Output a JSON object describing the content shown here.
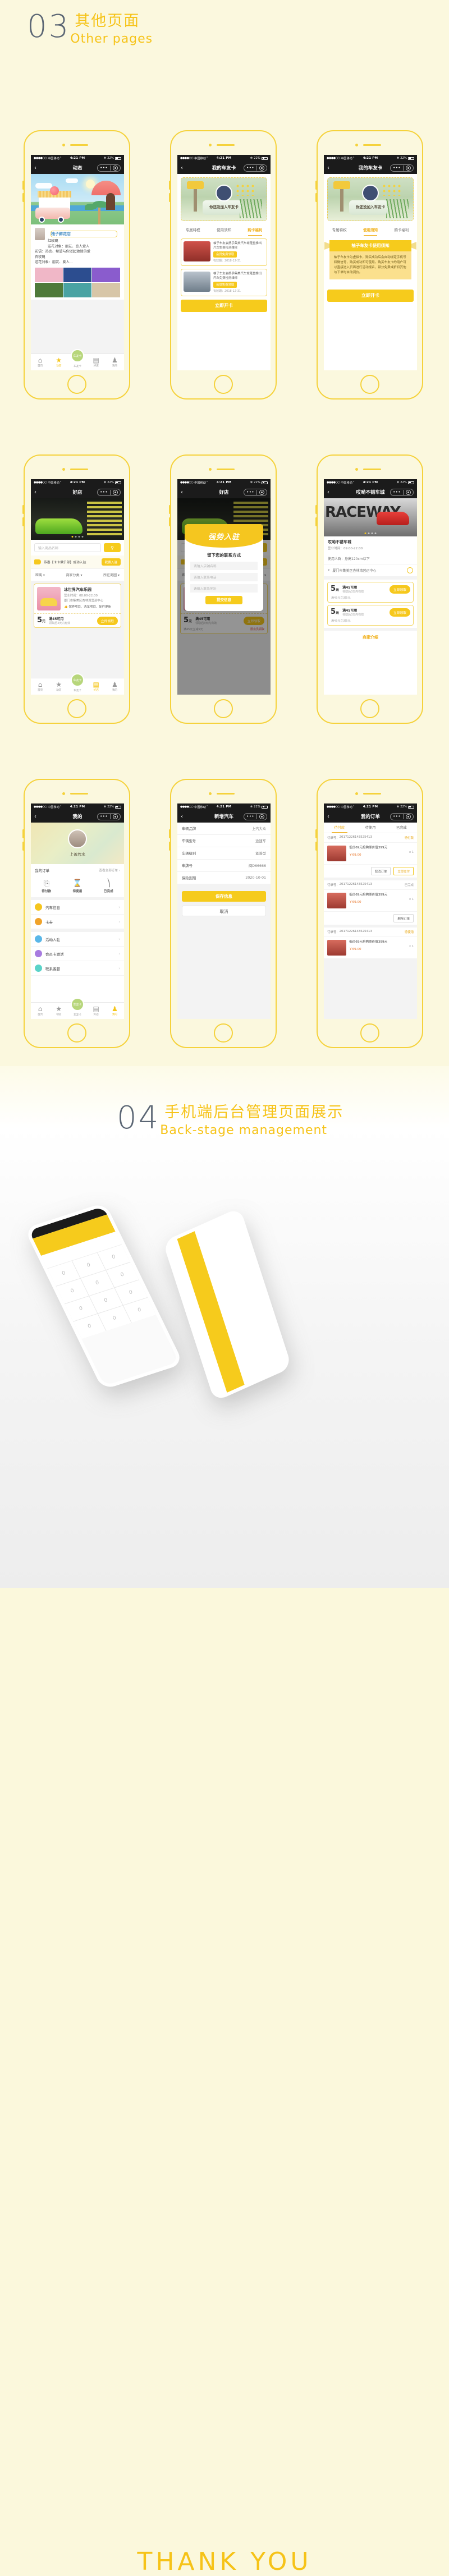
{
  "sections": {
    "other": {
      "num": "03",
      "cn": "其他页面",
      "en": "Other pages"
    },
    "backstage": {
      "num": "04",
      "cn": "手机端后台管理页面展示",
      "en": "Back-stage management"
    },
    "thanks": "THANK  YOU"
  },
  "status_bar": {
    "dots": "●●●●○○",
    "carrier": "中国移动",
    "wifi": "⌃",
    "time": "4:21 PM",
    "bluetooth": "✻",
    "battery": "22%"
  },
  "nav_icons": {
    "back": "‹",
    "more": "•••",
    "target": "◉"
  },
  "screens": [
    {
      "id": "dynamic-feed",
      "title": "动态",
      "post": {
        "shop": "柚子鲜花店",
        "lines": [
          "红玫瑰",
          "送花对象：朋友、恋人爱人",
          "花语：热恋、希望与你泛起激情的爱",
          "白玫瑰",
          "送花对象：朋友、爱人..."
        ],
        "photos": [
          "#f0b7c7",
          "#2c4d8f",
          "#8a5ccd",
          "#4f7a3a",
          "#49a3a3",
          "#d7c6a8"
        ]
      },
      "tabbar": [
        {
          "label": "首页",
          "glyph": "🏠",
          "active": false
        },
        {
          "label": "动态",
          "glyph": "★",
          "active": true
        },
        {
          "label": "车友卡",
          "glyph": "车友卡",
          "active": false,
          "center": true
        },
        {
          "label": "好店",
          "glyph": "🏪",
          "active": false
        },
        {
          "label": "我的",
          "glyph": "👤",
          "active": false
        }
      ]
    },
    {
      "id": "member-card-benefits",
      "title": "我的车友卡",
      "card_caption": "你还没加入车友卡",
      "tabs": [
        {
          "label": "专属特权",
          "active": false
        },
        {
          "label": "使用须知",
          "active": false
        },
        {
          "label": "购卡福利",
          "active": true
        }
      ],
      "coupons": [
        {
          "text": "柚子车友会携手集美汽车城隆重推出汽车免费检测维修",
          "pill": "会员免费领取",
          "expiry": "有效期：2018-12-31"
        },
        {
          "text": "柚子车友会携手集美汽车城隆重推出汽车免费检测维修",
          "pill": "会员免费领取",
          "expiry": "有效期：2018-12-31"
        }
      ],
      "cta": "立即开卡"
    },
    {
      "id": "member-card-notice",
      "title": "我的车友卡",
      "card_caption": "你还没加入车友卡",
      "tabs": [
        {
          "label": "专属特权",
          "active": false
        },
        {
          "label": "使用须知",
          "active": true
        },
        {
          "label": "购卡福利",
          "active": false
        }
      ],
      "ribbon": "柚子车友卡使用须知",
      "notice": "柚子车友卡为虚拟卡，购买成功后会自动绑定手机号和微信号，购买成功即可使用。购买车友卡的用户可以直接进入页面进行活动报名，部分免费或折扣其他与下单时自动调价。",
      "cta": "立即开卡"
    },
    {
      "id": "shop-list",
      "title": "好店",
      "search_placeholder": "输入商品名称",
      "search_icon": "🔍",
      "notice": "恭喜【卡卡俱乐部】成功入驻",
      "notice_button": "我要入驻",
      "filters": [
        "距离",
        "商家分类",
        "所在商圈"
      ],
      "shop": {
        "name": "冰世界汽车乐园",
        "hours": "营业时间：08:00-22:30",
        "address": "厦门市集美区杏林湾营运中心",
        "tags": "保养项目、洗车项目、配件更新"
      },
      "coupon": {
        "amount": "5",
        "unit": "元",
        "title": "满45可用",
        "sub": "领取后3天内有效",
        "button": "立即领取"
      },
      "tabbar": [
        {
          "label": "首页",
          "glyph": "🏠",
          "active": false
        },
        {
          "label": "动态",
          "glyph": "★",
          "active": false
        },
        {
          "label": "车友卡",
          "glyph": "车友卡",
          "active": false,
          "center": true
        },
        {
          "label": "好店",
          "glyph": "🏪",
          "active": true
        },
        {
          "label": "我的",
          "glyph": "👤",
          "active": false
        }
      ]
    },
    {
      "id": "join-dialog",
      "title": "好店",
      "dialog": {
        "logo": "强势入驻",
        "heading": "留下您的联系方式",
        "fields": [
          "请输入店铺名称",
          "请输入联系电话",
          "请输入联系地址"
        ],
        "submit": "提交信息"
      },
      "behind": {
        "coupon_amount": "5",
        "coupon_unit": "元",
        "coupon_title": "满45可用",
        "coupon_sub": "领取后3天内有效",
        "coupon_note": "满45元立减5元",
        "coupon_button": "立即领取",
        "member_note": "限会员领取",
        "tags": "保养项目、洗车项目、配件更新"
      }
    },
    {
      "id": "shop-detail",
      "title": "哎呦不错车城",
      "banner_word": "RACEWAY",
      "shop_name": "哎呦不错车城",
      "hours": "营业时间：09:00-22:00",
      "crowd": "使用人群：身高120cm以下",
      "address": "厦门市集美区杏林湾营运中心",
      "coupons": [
        {
          "amount": "5",
          "unit": "元",
          "title": "满45可用",
          "sub": "领取后3天内有效",
          "note": "满45元立减5元",
          "button": "立即领取"
        },
        {
          "amount": "5",
          "unit": "元",
          "title": "满45可用",
          "sub": "领取后3天内有效",
          "note": "满45元立减5元",
          "button": "立即领取"
        }
      ],
      "intro": "商家介绍"
    },
    {
      "id": "profile",
      "title": "我的",
      "user_name": "上善若水",
      "orders_label": "我的订单",
      "orders_all": "查看全部订单 ›",
      "order_states": [
        {
          "label": "待付款",
          "glyph": "🗒"
        },
        {
          "label": "待使用",
          "glyph": "⧗"
        },
        {
          "label": "已完成",
          "glyph": "🧾"
        }
      ],
      "menu": [
        {
          "label": "汽车信息",
          "color": "#f5c51c"
        },
        {
          "label": "卡券",
          "color": "#f0a32a"
        },
        {
          "label": "活动入驻",
          "color": "#5ab7e8"
        },
        {
          "label": "会员卡激活",
          "color": "#a87ce0"
        },
        {
          "label": "联系客服",
          "color": "#5ad3c8"
        }
      ],
      "tabbar": [
        {
          "label": "首页",
          "glyph": "🏠",
          "active": false
        },
        {
          "label": "动态",
          "glyph": "★",
          "active": false
        },
        {
          "label": "车友卡",
          "glyph": "车友卡",
          "active": false,
          "center": true
        },
        {
          "label": "好店",
          "glyph": "🏪",
          "active": false
        },
        {
          "label": "我的",
          "glyph": "👤",
          "active": true
        }
      ]
    },
    {
      "id": "add-car",
      "title": "新增汽车",
      "fields": [
        {
          "label": "车辆品牌",
          "value": "上汽大众"
        },
        {
          "label": "车辆型号",
          "value": "途速车"
        },
        {
          "label": "车辆级别",
          "value": "紧凑型"
        },
        {
          "label": "车牌号",
          "value": "闽D66666"
        },
        {
          "label": "保险到期",
          "value": "2020-10-01"
        }
      ],
      "save": "保存信息",
      "cancel": "取消"
    },
    {
      "id": "my-orders",
      "title": "我的订单",
      "tabs": [
        {
          "label": "待付款",
          "active": true
        },
        {
          "label": "待使用",
          "active": false
        },
        {
          "label": "已完成",
          "active": false
        }
      ],
      "orders": [
        {
          "no_label": "订单号：",
          "no": "20171226143525413",
          "status": "待付款",
          "item": "低价69元抢购原价值399元",
          "qty": "x 1",
          "price": "￥69.00",
          "actions": [
            {
              "label": "取消订单",
              "primary": false
            },
            {
              "label": "立即支付",
              "primary": true
            }
          ]
        },
        {
          "no_label": "订单号：",
          "no": "20171226143525413",
          "status": "已完成",
          "item": "低价69元抢购原价值399元",
          "qty": "x 1",
          "price": "￥69.00",
          "actions": [
            {
              "label": "删除订单",
              "primary": false
            }
          ]
        },
        {
          "no_label": "订单号：",
          "no": "20171226143525413",
          "status": "待使用",
          "item": "低价69元抢购原价值399元",
          "qty": "x 1",
          "price": "￥69.00",
          "actions": []
        }
      ]
    }
  ],
  "colors": {
    "brand_yellow": "#f6c81c",
    "page_bg": "#fbf8de",
    "frame": "#f5d23c",
    "accent_text": "#f6c318"
  }
}
